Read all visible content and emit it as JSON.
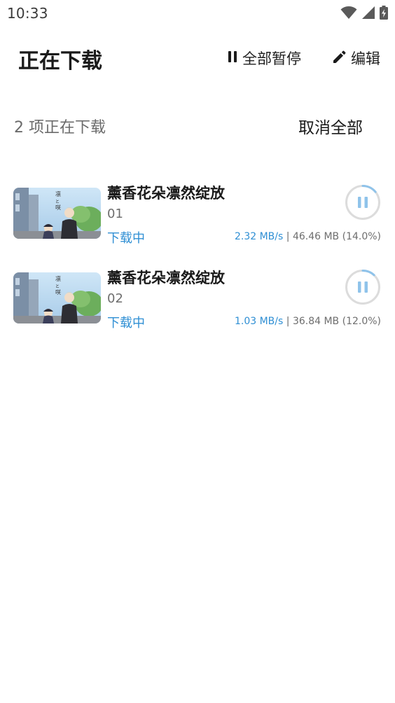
{
  "status_bar": {
    "time": "10:33",
    "icons": [
      "wifi-icon",
      "cell-signal-icon",
      "battery-charging-icon"
    ]
  },
  "header": {
    "title": "正在下载",
    "pause_all_label": "全部暂停",
    "edit_label": "编辑"
  },
  "summary": {
    "count_text": "2 项正在下载",
    "cancel_all_label": "取消全部"
  },
  "colors": {
    "accent": "#2f8fd4",
    "ring_track": "#dcdcdc",
    "ring_progress": "#8fc3ea"
  },
  "downloads": [
    {
      "title": "薰香花朵凛然绽放",
      "episode": "01",
      "status": "下载中",
      "speed": "2.32 MB/s",
      "separator": "|",
      "size_progress": "46.46 MB (14.0%)",
      "progress": 0.14
    },
    {
      "title": "薰香花朵凛然绽放",
      "episode": "02",
      "status": "下载中",
      "speed": "1.03 MB/s",
      "separator": "|",
      "size_progress": "36.84 MB (12.0%)",
      "progress": 0.12
    }
  ]
}
